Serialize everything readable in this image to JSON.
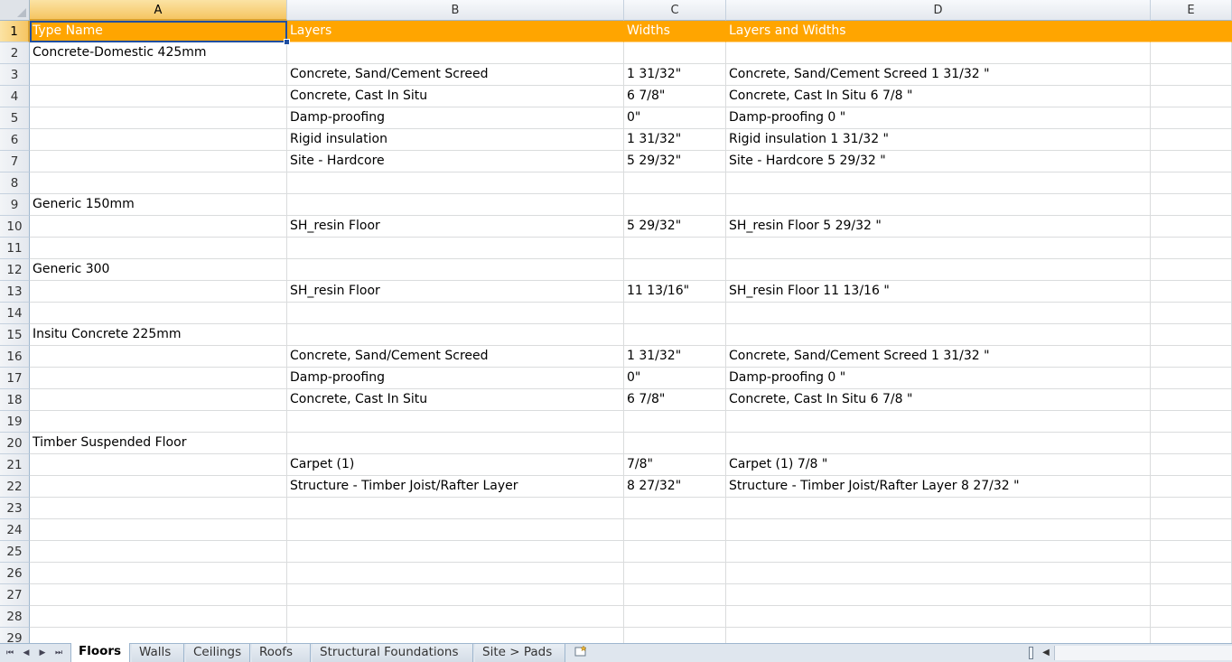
{
  "columns": [
    "A",
    "B",
    "C",
    "D",
    "E"
  ],
  "rows": [
    {
      "num": "1",
      "a": "Type Name",
      "b": "Layers",
      "c": "Widths",
      "d": "Layers and Widths"
    },
    {
      "num": "2",
      "a": "Concrete-Domestic 425mm",
      "b": "",
      "c": "",
      "d": ""
    },
    {
      "num": "3",
      "a": "",
      "b": "Concrete, Sand/Cement Screed",
      "c": "1 31/32\"",
      "d": "Concrete, Sand/Cement Screed 1 31/32 \""
    },
    {
      "num": "4",
      "a": "",
      "b": "Concrete, Cast In Situ",
      "c": "6 7/8\"",
      "d": "Concrete, Cast In Situ 6 7/8 \""
    },
    {
      "num": "5",
      "a": "",
      "b": "Damp-proofing",
      "c": "0\"",
      "d": "Damp-proofing 0 \""
    },
    {
      "num": "6",
      "a": "",
      "b": "Rigid insulation",
      "c": "1 31/32\"",
      "d": "Rigid insulation 1 31/32 \""
    },
    {
      "num": "7",
      "a": "",
      "b": "Site - Hardcore",
      "c": "5 29/32\"",
      "d": "Site - Hardcore 5 29/32 \""
    },
    {
      "num": "8",
      "a": "",
      "b": "",
      "c": "",
      "d": ""
    },
    {
      "num": "9",
      "a": "Generic 150mm",
      "b": "",
      "c": "",
      "d": ""
    },
    {
      "num": "10",
      "a": "",
      "b": "SH_resin Floor",
      "c": "5 29/32\"",
      "d": "SH_resin Floor 5 29/32 \""
    },
    {
      "num": "11",
      "a": "",
      "b": "",
      "c": "",
      "d": ""
    },
    {
      "num": "12",
      "a": "Generic 300",
      "b": "",
      "c": "",
      "d": ""
    },
    {
      "num": "13",
      "a": "",
      "b": "SH_resin Floor",
      "c": "11 13/16\"",
      "d": "SH_resin Floor 11 13/16 \""
    },
    {
      "num": "14",
      "a": "",
      "b": "",
      "c": "",
      "d": ""
    },
    {
      "num": "15",
      "a": "Insitu Concrete 225mm",
      "b": "",
      "c": "",
      "d": ""
    },
    {
      "num": "16",
      "a": "",
      "b": "Concrete, Sand/Cement Screed",
      "c": "1 31/32\"",
      "d": "Concrete, Sand/Cement Screed 1 31/32 \""
    },
    {
      "num": "17",
      "a": "",
      "b": "Damp-proofing",
      "c": "0\"",
      "d": "Damp-proofing 0 \""
    },
    {
      "num": "18",
      "a": "",
      "b": "Concrete, Cast In Situ",
      "c": "6 7/8\"",
      "d": "Concrete, Cast In Situ 6 7/8 \""
    },
    {
      "num": "19",
      "a": "",
      "b": "",
      "c": "",
      "d": ""
    },
    {
      "num": "20",
      "a": "Timber Suspended Floor",
      "b": "",
      "c": "",
      "d": ""
    },
    {
      "num": "21",
      "a": "",
      "b": "Carpet (1)",
      "c": "7/8\"",
      "d": "Carpet (1) 7/8 \""
    },
    {
      "num": "22",
      "a": "",
      "b": "Structure - Timber Joist/Rafter Layer",
      "c": "8 27/32\"",
      "d": "Structure - Timber Joist/Rafter Layer 8 27/32 \""
    },
    {
      "num": "23",
      "a": "",
      "b": "",
      "c": "",
      "d": ""
    },
    {
      "num": "24",
      "a": "",
      "b": "",
      "c": "",
      "d": ""
    },
    {
      "num": "25",
      "a": "",
      "b": "",
      "c": "",
      "d": ""
    },
    {
      "num": "26",
      "a": "",
      "b": "",
      "c": "",
      "d": ""
    },
    {
      "num": "27",
      "a": "",
      "b": "",
      "c": "",
      "d": ""
    },
    {
      "num": "28",
      "a": "",
      "b": "",
      "c": "",
      "d": ""
    },
    {
      "num": "29",
      "a": "",
      "b": "",
      "c": "",
      "d": ""
    }
  ],
  "tabs": [
    {
      "label": "Floors",
      "active": true
    },
    {
      "label": "Walls",
      "active": false
    },
    {
      "label": "Ceilings",
      "active": false
    },
    {
      "label": "Roofs",
      "active": false
    },
    {
      "label": "Structural Foundations",
      "active": false
    },
    {
      "label": "Site > Pads",
      "active": false
    }
  ],
  "nav": {
    "first": "⏮",
    "prev": "◀",
    "next": "▶",
    "last": "⏭"
  },
  "colors": {
    "header_fill": "#ffa500",
    "header_text": "#ffffff",
    "selection": "#1f4ea0"
  }
}
